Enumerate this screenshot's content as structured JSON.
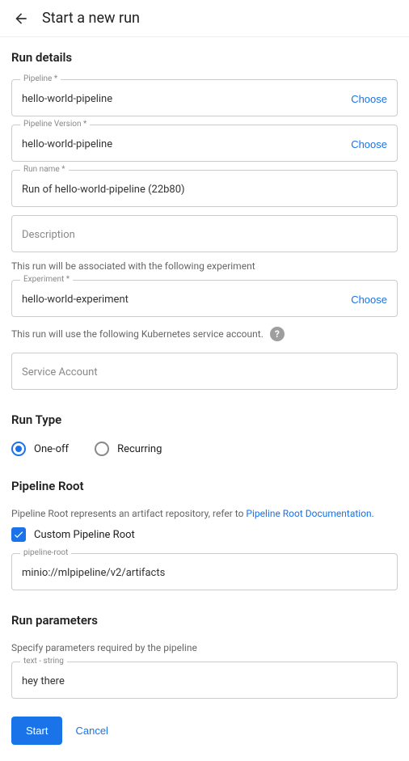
{
  "header": {
    "title": "Start a new run"
  },
  "sections": {
    "run_details": {
      "title": "Run details",
      "pipeline": {
        "label": "Pipeline *",
        "value": "hello-world-pipeline",
        "choose": "Choose"
      },
      "pipeline_version": {
        "label": "Pipeline Version *",
        "value": "hello-world-pipeline",
        "choose": "Choose"
      },
      "run_name": {
        "label": "Run name *",
        "value": "Run of hello-world-pipeline (22b80)"
      },
      "description": {
        "placeholder": "Description"
      },
      "experiment_helper": "This run will be associated with the following experiment",
      "experiment": {
        "label": "Experiment *",
        "value": "hello-world-experiment",
        "choose": "Choose"
      },
      "sa_helper": "This run will use the following Kubernetes service account.",
      "service_account": {
        "placeholder": "Service Account"
      }
    },
    "run_type": {
      "title": "Run Type",
      "options": {
        "one_off": "One-off",
        "recurring": "Recurring"
      }
    },
    "pipeline_root": {
      "title": "Pipeline Root",
      "helper_prefix": "Pipeline Root represents an artifact repository, refer to ",
      "helper_link": "Pipeline Root Documentation",
      "helper_suffix": ".",
      "checkbox_label": "Custom Pipeline Root",
      "field": {
        "label": "pipeline-root",
        "value": "minio://mlpipeline/v2/artifacts"
      }
    },
    "run_parameters": {
      "title": "Run parameters",
      "helper": "Specify parameters required by the pipeline",
      "param": {
        "label": "text - string",
        "value": "hey there"
      }
    }
  },
  "buttons": {
    "start": "Start",
    "cancel": "Cancel"
  }
}
